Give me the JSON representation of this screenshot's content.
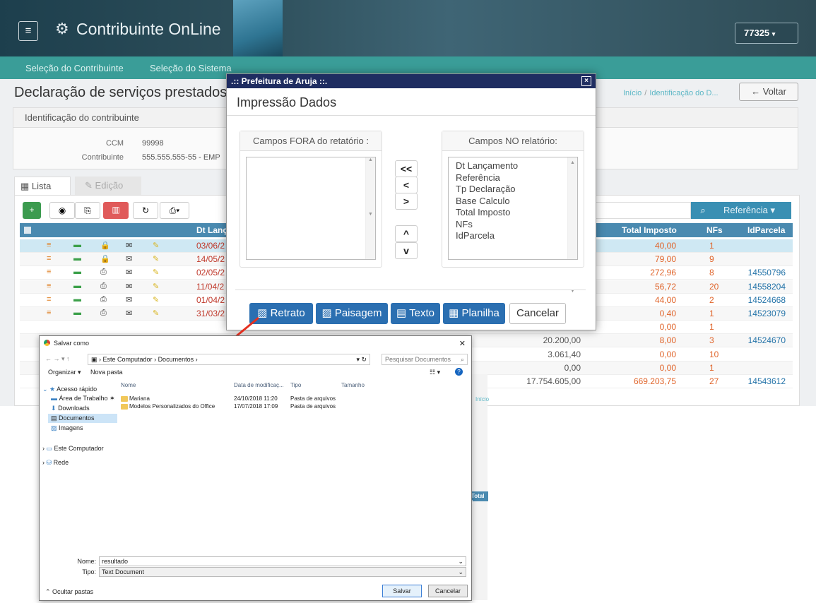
{
  "app": {
    "title": "Contribuinte OnLine",
    "user": "77325"
  },
  "nav": {
    "items": [
      "Seleção do Contribuinte",
      "Seleção do Sistema"
    ]
  },
  "page": {
    "title": "Declaração de serviços prestados",
    "breadcrumb_home": "Início",
    "breadcrumb_sep": "/",
    "breadcrumb_current": "Identificação do D...",
    "back_label": "Voltar"
  },
  "identification": {
    "title": "Identificação do contribuinte",
    "ccm_label": "CCM",
    "ccm_value": "99998",
    "contrib_label": "Contribuinte",
    "contrib_value": "555.555.555-55 - EMP"
  },
  "tabs": {
    "lista": "Lista",
    "edicao": "Edição"
  },
  "grid": {
    "reference_label": "Referência",
    "columns": [
      "Dt Lanç",
      "Total Imposto",
      "NFs",
      "IdParcela"
    ],
    "rows": [
      {
        "date": "03/06/2",
        "total": "40,00",
        "nfs": "1",
        "parcela": ""
      },
      {
        "date": "14/05/2",
        "total": "79,00",
        "nfs": "9",
        "parcela": ""
      },
      {
        "date": "02/05/2",
        "total": "272,96",
        "nfs": "8",
        "parcela": "14550796"
      },
      {
        "date": "11/04/2",
        "total": "56,72",
        "nfs": "20",
        "parcela": "14558204"
      },
      {
        "date": "01/04/2",
        "total": "44,00",
        "nfs": "2",
        "parcela": "14524668"
      },
      {
        "date": "31/03/2",
        "total": "0,40",
        "nfs": "1",
        "parcela": "14523079"
      },
      {
        "date": "",
        "total": "0,00",
        "nfs": "1",
        "parcela": ""
      },
      {
        "date": "",
        "base": "20.200,00",
        "total": "8,00",
        "nfs": "3",
        "parcela": "14524670"
      },
      {
        "date": "",
        "base": "3.061,40",
        "total": "0,00",
        "nfs": "10",
        "parcela": ""
      },
      {
        "date": "",
        "base": "0,00",
        "total": "0,00",
        "nfs": "1",
        "parcela": ""
      },
      {
        "date": "",
        "base": "17.754.605,00",
        "total": "669.203,75",
        "nfs": "27",
        "parcela": "14543612"
      }
    ]
  },
  "modal": {
    "window_title": ".:: Prefeitura de Aruja ::.",
    "title": "Impressão Dados",
    "left_title": "Campos FORA do retatório :",
    "right_title": "Campos NO relatório:",
    "right_items": [
      "Dt Lançamento",
      "Referência",
      "Tp Declaração",
      "Base Calculo",
      "Total Imposto",
      "NFs",
      "IdParcela"
    ],
    "move_buttons": [
      "<<",
      "<",
      ">",
      "^",
      "v"
    ],
    "buttons": {
      "retrato": "Retrato",
      "paisagem": "Paisagem",
      "texto": "Texto",
      "planilha": "Planilha",
      "cancelar": "Cancelar"
    }
  },
  "save_dialog": {
    "title": "Salvar como",
    "path": [
      "Este Computador",
      "Documentos"
    ],
    "search_placeholder": "Pesquisar Documentos",
    "organize": "Organizar ▾",
    "new_folder": "Nova pasta",
    "nav": [
      "Acesso rápido",
      "Área de Trabalho",
      "Downloads",
      "Documentos",
      "Imagens",
      "Este Computador",
      "Rede"
    ],
    "columns": [
      "Nome",
      "Data de modificaç...",
      "Tipo",
      "Tamanho"
    ],
    "files": [
      {
        "name": "Mariana",
        "date": "24/10/2018 11:20",
        "type": "Pasta de arquivos"
      },
      {
        "name": "Modelos Personalizados do Office",
        "date": "17/07/2018 17:09",
        "type": "Pasta de arquivos"
      }
    ],
    "filename_label": "Nome:",
    "filename": "resultado",
    "type_label": "Tipo:",
    "type_value": "Text Document",
    "hide_folders": "Ocultar pastas",
    "save": "Salvar",
    "cancel": "Cancelar"
  },
  "behind": {
    "inicio": "Início",
    "total": "Total I"
  }
}
